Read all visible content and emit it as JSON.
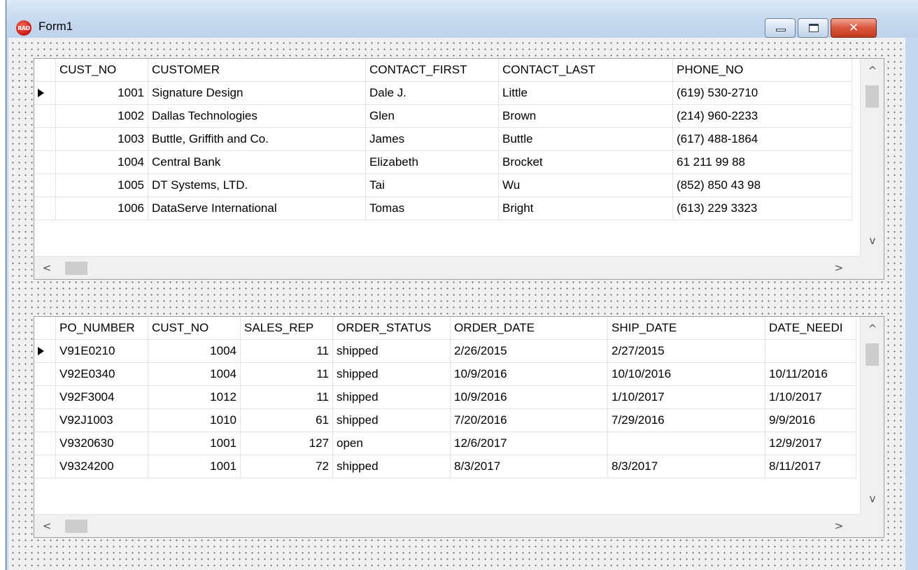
{
  "window": {
    "title": "Form1",
    "app_icon_text": "RAD",
    "minimize_icon": "minimize-icon",
    "maximize_icon": "maximize-icon",
    "close_icon": "close-icon"
  },
  "customers_grid": {
    "columns": [
      "CUST_NO",
      "CUSTOMER",
      "CONTACT_FIRST",
      "CONTACT_LAST",
      "PHONE_NO"
    ],
    "current_row": 0,
    "rows": [
      [
        "1001",
        "Signature Design",
        "Dale J.",
        "Little",
        "(619) 530-2710"
      ],
      [
        "1002",
        "Dallas Technologies",
        "Glen",
        "Brown",
        "(214) 960-2233"
      ],
      [
        "1003",
        "Buttle, Griffith and Co.",
        "James",
        "Buttle",
        "(617) 488-1864"
      ],
      [
        "1004",
        "Central Bank",
        "Elizabeth",
        "Brocket",
        "61 211 99 88"
      ],
      [
        "1005",
        "DT Systems, LTD.",
        "Tai",
        "Wu",
        "(852) 850 43 98"
      ],
      [
        "1006",
        "DataServe International",
        "Tomas",
        "Bright",
        "(613) 229 3323"
      ]
    ]
  },
  "orders_grid": {
    "columns": [
      "PO_NUMBER",
      "CUST_NO",
      "SALES_REP",
      "ORDER_STATUS",
      "ORDER_DATE",
      "SHIP_DATE",
      "DATE_NEEDI"
    ],
    "current_row": 0,
    "rows": [
      [
        "V91E0210",
        "1004",
        "11",
        "shipped",
        "2/26/2015",
        "2/27/2015",
        ""
      ],
      [
        "V92E0340",
        "1004",
        "11",
        "shipped",
        "10/9/2016",
        "10/10/2016",
        "10/11/2016"
      ],
      [
        "V92F3004",
        "1012",
        "11",
        "shipped",
        "10/9/2016",
        "1/10/2017",
        "1/10/2017"
      ],
      [
        "V92J1003",
        "1010",
        "61",
        "shipped",
        "7/20/2016",
        "7/29/2016",
        "9/9/2016"
      ],
      [
        "V9320630",
        "1001",
        "127",
        "open",
        "12/6/2017",
        "",
        "12/9/2017"
      ],
      [
        "V9324200",
        "1001",
        "72",
        "shipped",
        "8/3/2017",
        "8/3/2017",
        "8/11/2017"
      ]
    ]
  },
  "scrollbar": {
    "up": "▲",
    "down": "˅",
    "left": "<",
    "right": ">",
    "up_glyph": "^",
    "down_glyph": "v"
  }
}
